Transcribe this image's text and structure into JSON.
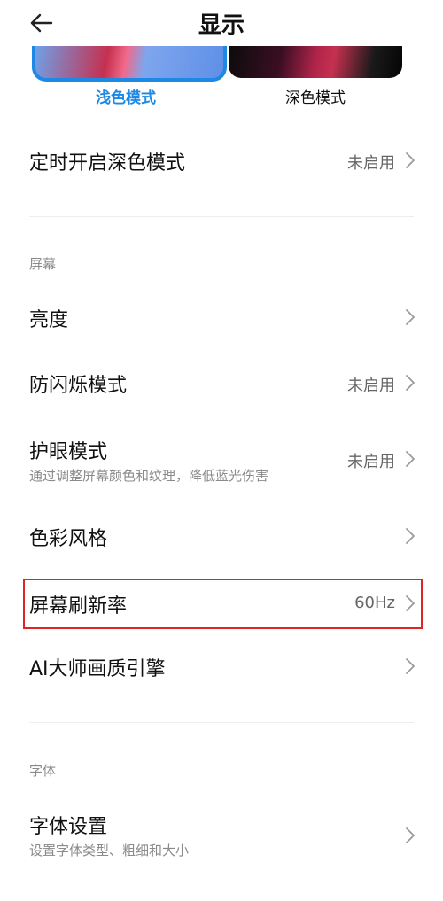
{
  "header": {
    "title": "显示",
    "back_icon": "arrow-left-icon"
  },
  "theme": {
    "light_label": "浅色模式",
    "dark_label": "深色模式",
    "accent_color": "#1e88e5"
  },
  "rows": {
    "dark_schedule": {
      "title": "定时开启深色模式",
      "value": "未启用"
    },
    "brightness": {
      "title": "亮度"
    },
    "anti_flicker": {
      "title": "防闪烁模式",
      "value": "未启用"
    },
    "eye_care": {
      "title": "护眼模式",
      "subtitle": "通过调整屏幕颜色和纹理，降低蓝光伤害",
      "value": "未启用"
    },
    "color_style": {
      "title": "色彩风格"
    },
    "refresh_rate": {
      "title": "屏幕刷新率",
      "value": "60Hz"
    },
    "ai_engine": {
      "title": "AI大师画质引擎"
    },
    "font_settings": {
      "title": "字体设置",
      "subtitle": "设置字体类型、粗细和大小"
    }
  },
  "sections": {
    "screen": "屏幕",
    "font": "字体"
  },
  "highlight_color": "#e02424"
}
